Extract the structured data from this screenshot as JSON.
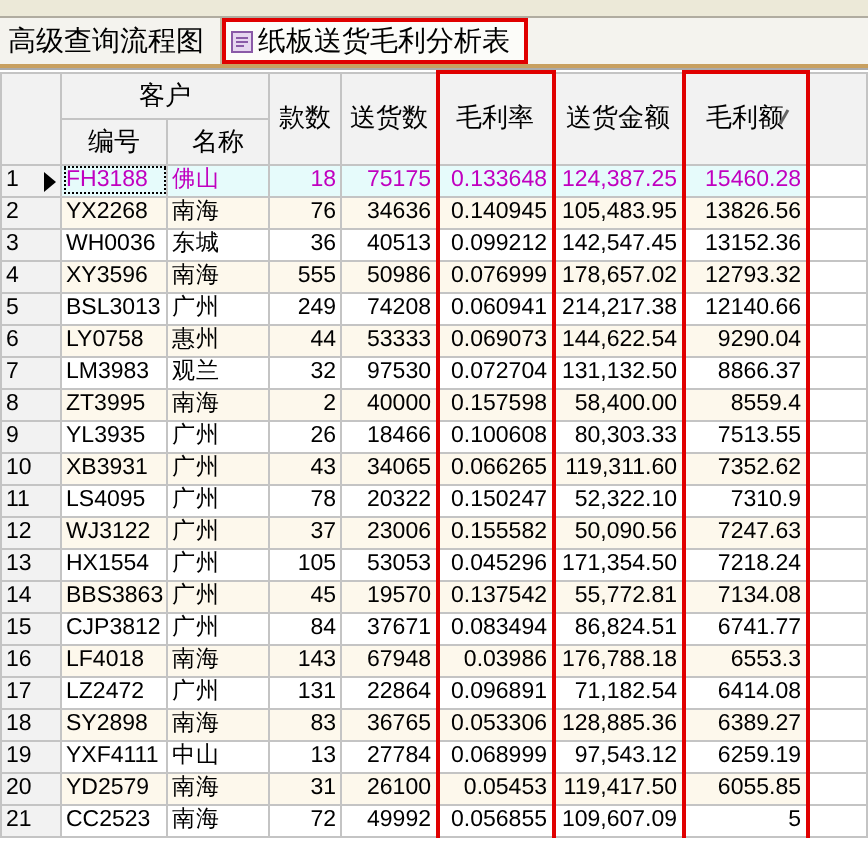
{
  "tabs": [
    {
      "label": "高级查询流程图",
      "selected": false,
      "highlighted": false
    },
    {
      "label": "纸板送货毛利分析表",
      "selected": true,
      "highlighted": true
    }
  ],
  "table": {
    "group_header": {
      "label": "客户"
    },
    "columns": [
      {
        "label": "编号",
        "grouped": true,
        "highlighted": false,
        "sorted": false
      },
      {
        "label": "名称",
        "grouped": true,
        "highlighted": false,
        "sorted": false
      },
      {
        "label": "款数",
        "grouped": false,
        "highlighted": false,
        "sorted": false
      },
      {
        "label": "送货数",
        "grouped": false,
        "highlighted": false,
        "sorted": false
      },
      {
        "label": "毛利率",
        "grouped": false,
        "highlighted": true,
        "sorted": false
      },
      {
        "label": "送货金额",
        "grouped": false,
        "highlighted": false,
        "sorted": false
      },
      {
        "label": "毛利额",
        "grouped": false,
        "highlighted": true,
        "sorted": true
      }
    ],
    "rows": [
      {
        "index": "1",
        "selected": true,
        "cells": [
          "FH3188",
          "佛山",
          "18",
          "75175",
          "0.133648",
          "124,387.25",
          "15460.28"
        ]
      },
      {
        "index": "2",
        "selected": false,
        "cells": [
          "YX2268",
          "南海",
          "76",
          "34636",
          "0.140945",
          "105,483.95",
          "13826.56"
        ]
      },
      {
        "index": "3",
        "selected": false,
        "cells": [
          "WH0036",
          "东城",
          "36",
          "40513",
          "0.099212",
          "142,547.45",
          "13152.36"
        ]
      },
      {
        "index": "4",
        "selected": false,
        "cells": [
          "XY3596",
          "南海",
          "555",
          "50986",
          "0.076999",
          "178,657.02",
          "12793.32"
        ]
      },
      {
        "index": "5",
        "selected": false,
        "cells": [
          "BSL3013",
          "广州",
          "249",
          "74208",
          "0.060941",
          "214,217.38",
          "12140.66"
        ]
      },
      {
        "index": "6",
        "selected": false,
        "cells": [
          "LY0758",
          "惠州",
          "44",
          "53333",
          "0.069073",
          "144,622.54",
          "9290.04"
        ]
      },
      {
        "index": "7",
        "selected": false,
        "cells": [
          "LM3983",
          "观兰",
          "32",
          "97530",
          "0.072704",
          "131,132.50",
          "8866.37"
        ]
      },
      {
        "index": "8",
        "selected": false,
        "cells": [
          "ZT3995",
          "南海",
          "2",
          "40000",
          "0.157598",
          "58,400.00",
          "8559.4"
        ]
      },
      {
        "index": "9",
        "selected": false,
        "cells": [
          "YL3935",
          "广州",
          "26",
          "18466",
          "0.100608",
          "80,303.33",
          "7513.55"
        ]
      },
      {
        "index": "10",
        "selected": false,
        "cells": [
          "XB3931",
          "广州",
          "43",
          "34065",
          "0.066265",
          "119,311.60",
          "7352.62"
        ]
      },
      {
        "index": "11",
        "selected": false,
        "cells": [
          "LS4095",
          "广州",
          "78",
          "20322",
          "0.150247",
          "52,322.10",
          "7310.9"
        ]
      },
      {
        "index": "12",
        "selected": false,
        "cells": [
          "WJ3122",
          "广州",
          "37",
          "23006",
          "0.155582",
          "50,090.56",
          "7247.63"
        ]
      },
      {
        "index": "13",
        "selected": false,
        "cells": [
          "HX1554",
          "广州",
          "105",
          "53053",
          "0.045296",
          "171,354.50",
          "7218.24"
        ]
      },
      {
        "index": "14",
        "selected": false,
        "cells": [
          "BBS3863",
          "广州",
          "45",
          "19570",
          "0.137542",
          "55,772.81",
          "7134.08"
        ]
      },
      {
        "index": "15",
        "selected": false,
        "cells": [
          "CJP3812",
          "广州",
          "84",
          "37671",
          "0.083494",
          "86,824.51",
          "6741.77"
        ]
      },
      {
        "index": "16",
        "selected": false,
        "cells": [
          "LF4018",
          "南海",
          "143",
          "67948",
          "0.03986",
          "176,788.18",
          "6553.3"
        ]
      },
      {
        "index": "17",
        "selected": false,
        "cells": [
          "LZ2472",
          "广州",
          "131",
          "22864",
          "0.096891",
          "71,182.54",
          "6414.08"
        ]
      },
      {
        "index": "18",
        "selected": false,
        "cells": [
          "SY2898",
          "南海",
          "83",
          "36765",
          "0.053306",
          "128,885.36",
          "6389.27"
        ]
      },
      {
        "index": "19",
        "selected": false,
        "cells": [
          "YXF4111",
          "中山",
          "13",
          "27784",
          "0.068999",
          "97,543.12",
          "6259.19"
        ]
      },
      {
        "index": "20",
        "selected": false,
        "cells": [
          "YD2579",
          "南海",
          "31",
          "26100",
          "0.05453",
          "119,417.50",
          "6055.85"
        ]
      },
      {
        "index": "21",
        "selected": false,
        "cells": [
          "CC2523",
          "南海",
          "72",
          "49992",
          "0.056855",
          "109,607.09",
          "5"
        ]
      }
    ]
  }
}
